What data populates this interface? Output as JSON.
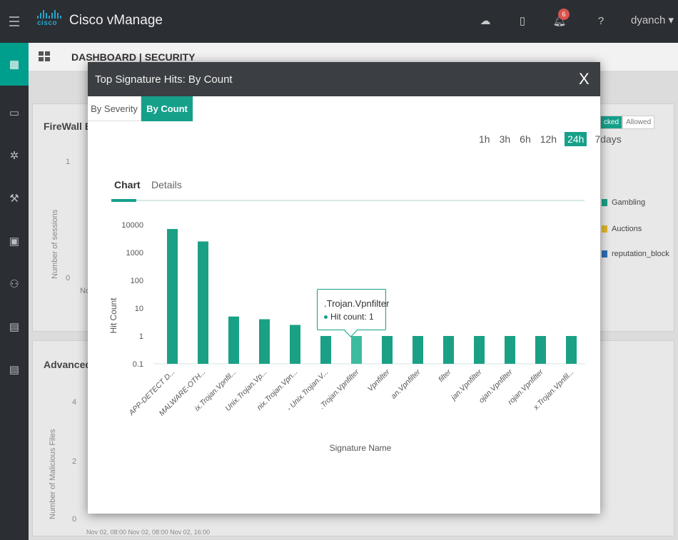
{
  "app": {
    "brand_text": "cisco",
    "title": "Cisco vManage",
    "user": "dyanch ▾",
    "notification_count": "6"
  },
  "breadcrumb": "DASHBOARD | SECURITY",
  "background": {
    "panel1_title": "FireWall Enforcement",
    "panel1_ylabel": "Number of sessions",
    "panel1_ytick_top": "1",
    "panel1_ytick_bottom": "0",
    "panel1_xfrag": "No",
    "panel2_title": "Advanced Malware",
    "panel2_ylabel": "Number of Malicious Files",
    "panel2_ytick_top": "4",
    "panel2_ytick_mid": "2",
    "panel2_ytick_bottom": "0",
    "panel2_xaxis": "Nov 02, 08:00  Nov 02, 08:00  Nov 02, 16:00",
    "toggle": [
      "cked",
      "Allowed"
    ],
    "legend": [
      {
        "label": "Gambling",
        "color": "#1aa085"
      },
      {
        "label": "Auctions",
        "color": "#e0b52f"
      },
      {
        "label": "reputation_block",
        "color": "#2f6db5"
      }
    ]
  },
  "modal": {
    "title": "Top Signature Hits: By Count",
    "close": "X",
    "segments": {
      "by_severity": "By Severity",
      "by_count": "By Count"
    },
    "time_ranges": [
      "1h",
      "3h",
      "6h",
      "12h",
      "24h",
      "7days"
    ],
    "active_time_range": "24h",
    "tabs": {
      "chart": "Chart",
      "details": "Details"
    },
    "tooltip": {
      "title": ".Trojan.Vpnfilter",
      "line": "Hit count: 1"
    }
  },
  "chart_data": {
    "type": "bar",
    "ylabel": "Hit Count",
    "xlabel": "Signature Name",
    "yscale": "log",
    "ylim": [
      0.1,
      10000
    ],
    "yticks": [
      "10000",
      "1000",
      "100",
      "10",
      "1",
      "0.1"
    ],
    "color": "#1aa085",
    "highlight_color": "#3dbb9f",
    "highlight_index": 6,
    "categories": [
      "APP-DETECT D...",
      "MALWARE-OTH...",
      "ix.Trojan.Vpnfil...",
      "Unix.Trojan.Vp...",
      "nix.Trojan.Vpn...",
      "- Unix.Trojan.V...",
      ".Trojan.Vpnfilter",
      "Vpnfilter",
      "an.Vpnfilter",
      "filter",
      "jan.Vpnfilter",
      "ojan.Vpnfilter",
      "rojan.Vpnfilter",
      "x.Trojan.Vpnfil..."
    ],
    "values": [
      7000,
      2500,
      5,
      4,
      2.5,
      1,
      1,
      1,
      1,
      1,
      1,
      1,
      1,
      1
    ]
  }
}
